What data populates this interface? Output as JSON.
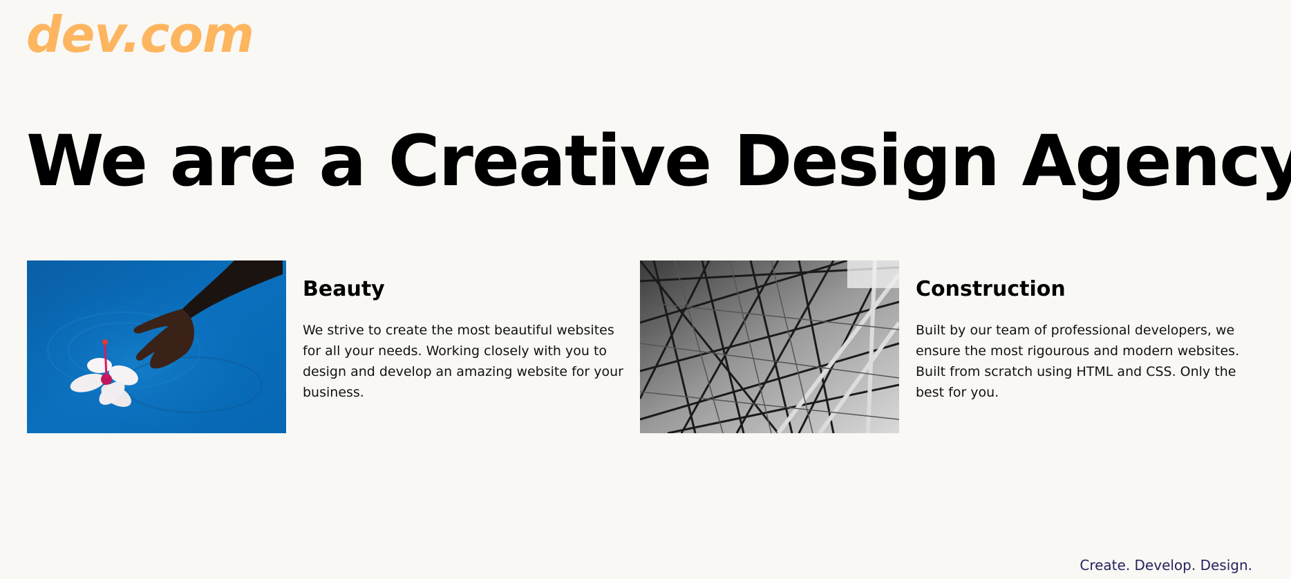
{
  "brand": {
    "logo_text": "dev.com",
    "logo_color": "#fdb55f"
  },
  "hero": {
    "title": "We are a Creative Design Agency"
  },
  "services": [
    {
      "title": "Beauty",
      "description": "We strive to create the most beautiful websites for all your needs. Working closely with you to design and develop an amazing website for your business.",
      "image": "hand-in-blue-water-with-flower-photo"
    },
    {
      "title": "Construction",
      "description": "Built by our team of professional developers, we ensure the most rigourous and modern websites. Built from scratch using HTML and CSS. Only the best for you.",
      "image": "steel-scaffolding-black-and-white-photo"
    }
  ],
  "footer": {
    "tagline": "Create. Develop. Design.",
    "tagline_color": "#26245e"
  }
}
